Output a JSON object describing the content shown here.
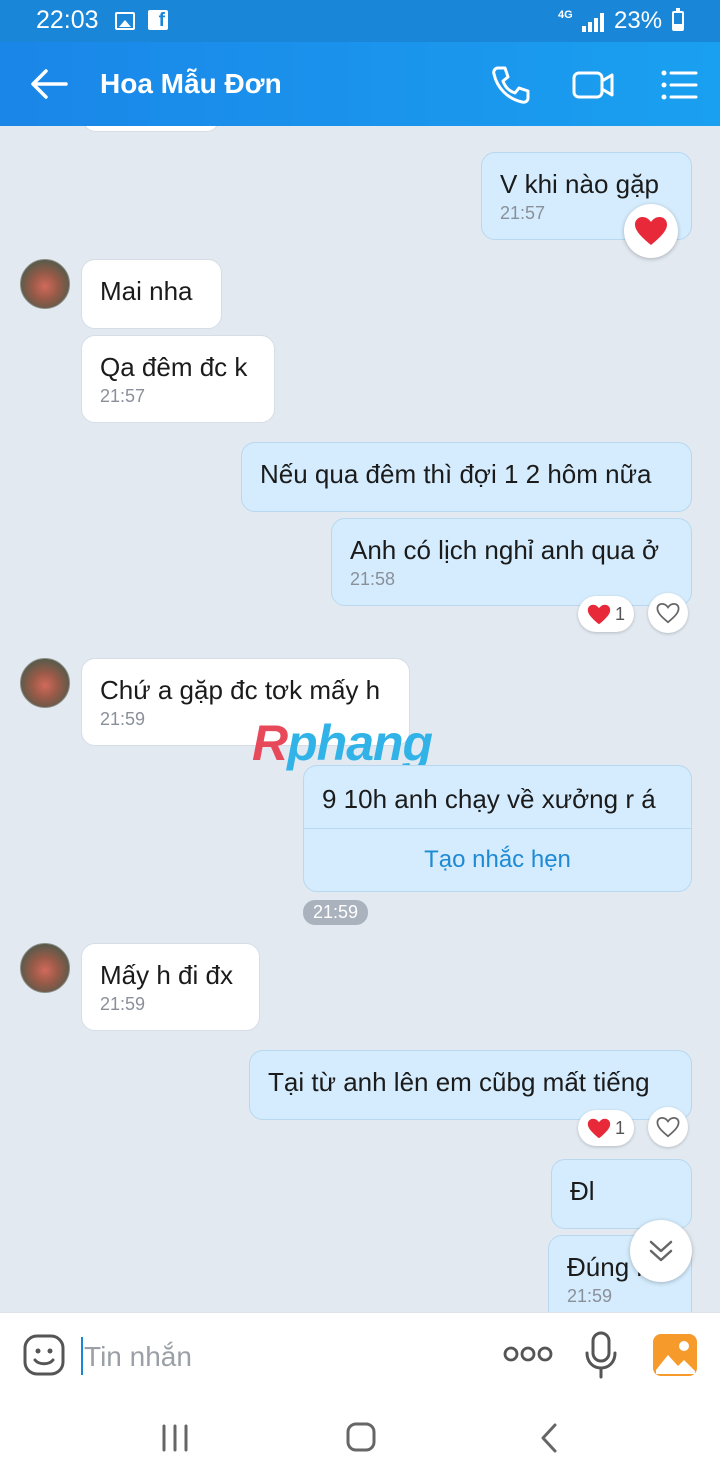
{
  "status_bar": {
    "time": "22:03",
    "network": "4G",
    "battery": "23%",
    "icons": [
      "image-icon",
      "facebook-icon",
      "signal-icon",
      "battery-charging-icon"
    ]
  },
  "header": {
    "contact_name": "Hoa Mẫu Đơn",
    "icons": [
      "back-arrow-icon",
      "phone-icon",
      "video-call-icon",
      "menu-list-icon"
    ]
  },
  "messages": [
    {
      "side": "me",
      "text": "V khi nào gặp",
      "time": "21:57",
      "reaction": "heart"
    },
    {
      "side": "them",
      "text": "Mai nha"
    },
    {
      "side": "them",
      "text": "Qa đêm đc k",
      "time": "21:57"
    },
    {
      "side": "me",
      "text": "Nếu qua đêm thì đợi 1 2 hôm nữa"
    },
    {
      "side": "me",
      "text": "Anh có lịch nghỉ anh qua ở",
      "time": "21:58",
      "reaction_count": "1"
    },
    {
      "side": "them",
      "text": "Chứ a gặp đc tơk mấy h",
      "time": "21:59"
    },
    {
      "side": "me",
      "text": "9 10h anh chạy về xưởng r á",
      "action": "Tạo nhắc hẹn"
    },
    {
      "side": "them",
      "text": "Mấy h đi đx",
      "time": "21:59"
    },
    {
      "side": "me",
      "text": "Tại từ anh lên em cũbg mất tiếng",
      "reaction_count": "1"
    },
    {
      "side": "me",
      "text": "Đl"
    },
    {
      "side": "me",
      "text": "Đúng r",
      "time": "21:59"
    }
  ],
  "time_separator": "21:59",
  "watermark": {
    "r": "R",
    "rest": "phang"
  },
  "input": {
    "placeholder": "Tin nhắn"
  },
  "colors": {
    "header": "#1a86e8",
    "my_bubble": "#d4ecfd",
    "their_bubble": "#ffffff",
    "link": "#1f8ad4",
    "heart": "#e8293a"
  }
}
